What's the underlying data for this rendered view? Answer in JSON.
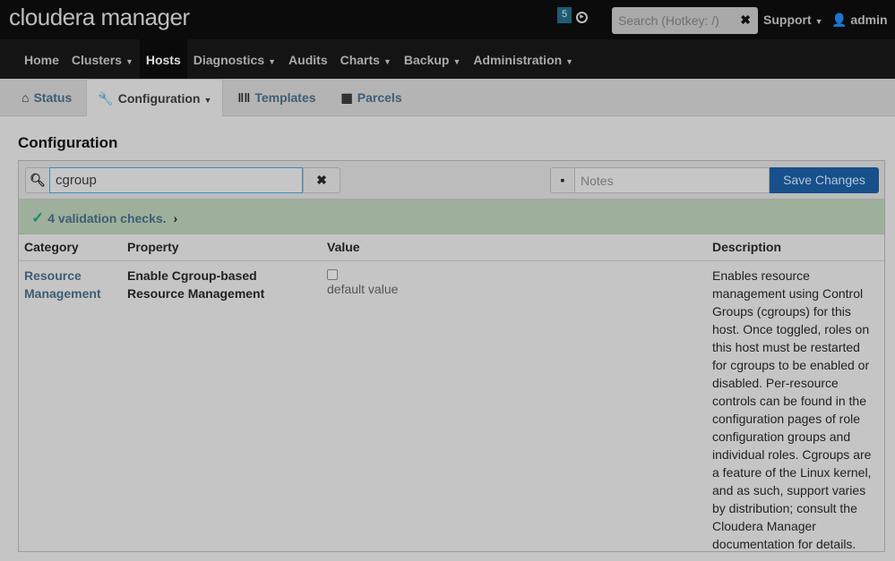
{
  "header": {
    "logo": "cloudera manager",
    "badge": "5",
    "search_placeholder": "Search (Hotkey: /)",
    "support": "Support",
    "user": "admin"
  },
  "nav": [
    "Home",
    "Clusters",
    "Hosts",
    "Diagnostics",
    "Audits",
    "Charts",
    "Backup",
    "Administration"
  ],
  "tabs": [
    "Status",
    "Configuration",
    "Templates",
    "Parcels"
  ],
  "page_title": "Configuration",
  "toolbar": {
    "filter_value": "cgroup",
    "notes_placeholder": "Notes",
    "save_label": "Save Changes"
  },
  "validation": "4 validation checks.",
  "table": {
    "headers": [
      "Category",
      "Property",
      "Value",
      "Description"
    ],
    "rows": [
      {
        "category": "Resource Management",
        "property": "Enable Cgroup-based Resource Management",
        "value": "default value",
        "description": "Enables resource management using Control Groups (cgroups) for this host. Once toggled, roles on this host must be restarted for cgroups to be enabled or disabled. Per-resource controls can be found in the configuration pages of role configuration groups and individual roles. Cgroups are a feature of the Linux kernel, and as such, support varies by distribution; consult the Cloudera Manager documentation for details."
      }
    ]
  }
}
